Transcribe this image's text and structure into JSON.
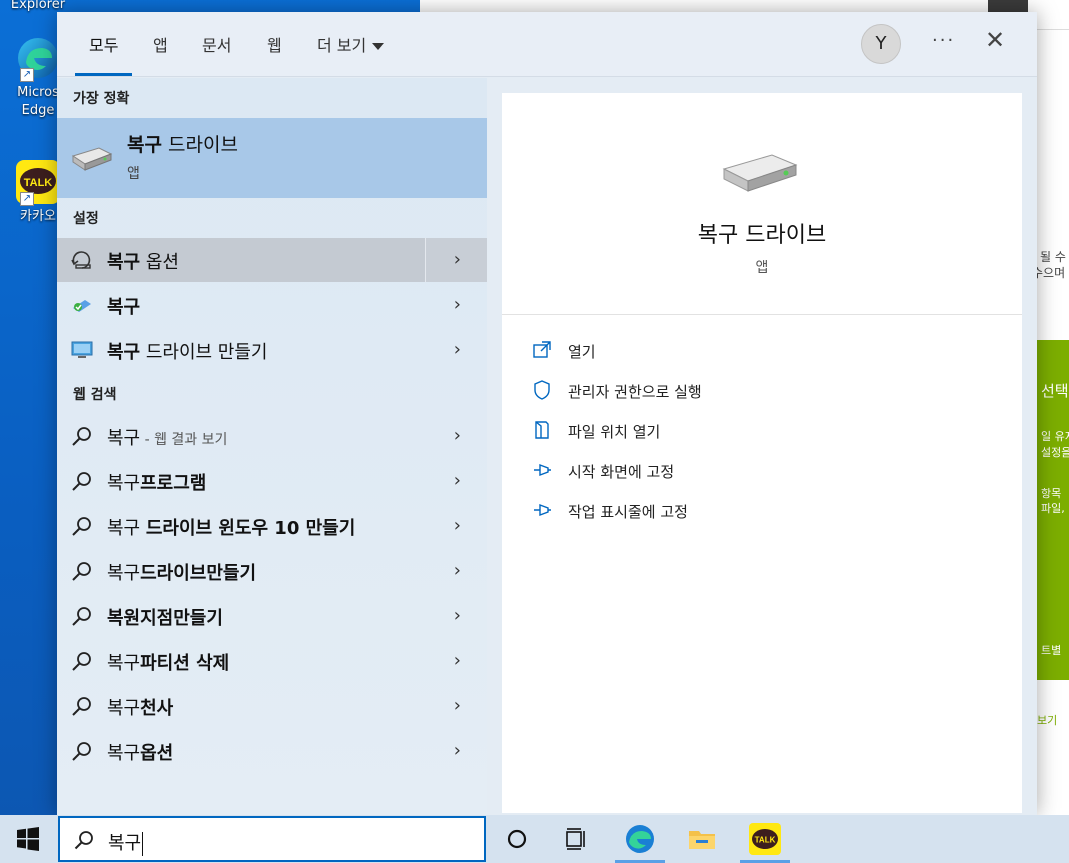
{
  "desktop": {
    "icons": [
      {
        "label_line1": "Explorer",
        "label_line2": ""
      },
      {
        "label_line1": "Micros",
        "label_line2": "Edge"
      },
      {
        "label_line1": "카카오",
        "label_line2": ""
      }
    ],
    "talk_label": "TALK"
  },
  "bg_window": {
    "text_a": "될 수",
    "text_b": "수으며",
    "side_a": "선택",
    "side_b": "일 유지",
    "side_c": "설정을",
    "side_d": "항목 ",
    "side_e": "파일,",
    "side_f": "트별",
    "side_g": "보기"
  },
  "search_panel": {
    "tabs": [
      {
        "label": "모두",
        "active": true
      },
      {
        "label": "앱",
        "active": false
      },
      {
        "label": "문서",
        "active": false
      },
      {
        "label": "웹",
        "active": false
      },
      {
        "label": "더 보기",
        "active": false
      }
    ],
    "avatar_initial": "Y",
    "more_label": "···",
    "close_label": "✕",
    "best_match_header": "가장 정확",
    "best_match": {
      "title_bold": "복구",
      "title_rest": " 드라이브",
      "subtitle": "앱"
    },
    "settings_header": "설정",
    "settings": [
      {
        "bold": "복구",
        "rest": " 옵션",
        "icon": "recovery-options-icon"
      },
      {
        "bold": "복구",
        "rest": "",
        "icon": "recovery-icon"
      },
      {
        "bold": "복구",
        "rest": " 드라이브 만들기",
        "icon": "monitor-icon"
      }
    ],
    "web_header": "웹 검색",
    "web_results": [
      {
        "normal": "복구",
        "bold": "",
        "suffix": " - 웹 결과 보기"
      },
      {
        "normal": "복구",
        "bold": "프로그램",
        "suffix": ""
      },
      {
        "normal": "복구 ",
        "bold": "드라이브 윈도우 10 만들기",
        "suffix": ""
      },
      {
        "normal": "복구",
        "bold": "드라이브만들기",
        "suffix": ""
      },
      {
        "normal": "",
        "bold": "복원지점만들기",
        "suffix": ""
      },
      {
        "normal": "복구",
        "bold": "파티션 삭제",
        "suffix": ""
      },
      {
        "normal": "복구",
        "bold": "천사",
        "suffix": ""
      },
      {
        "normal": "복구",
        "bold": "옵션",
        "suffix": ""
      }
    ],
    "detail": {
      "title": "복구 드라이브",
      "subtitle": "앱",
      "actions": [
        {
          "label": "열기",
          "icon": "open-icon"
        },
        {
          "label": "관리자 권한으로 실행",
          "icon": "shield-icon"
        },
        {
          "label": "파일 위치 열기",
          "icon": "file-location-icon"
        },
        {
          "label": "시작 화면에 고정",
          "icon": "pin-icon"
        },
        {
          "label": "작업 표시줄에 고정",
          "icon": "pin-icon"
        }
      ]
    }
  },
  "taskbar": {
    "search_text": "복구",
    "talk_label": "TALK"
  },
  "colors": {
    "accent": "#0067c0",
    "best_match_bg": "#a8c8e8",
    "selected_bg": "#c4cad2"
  }
}
